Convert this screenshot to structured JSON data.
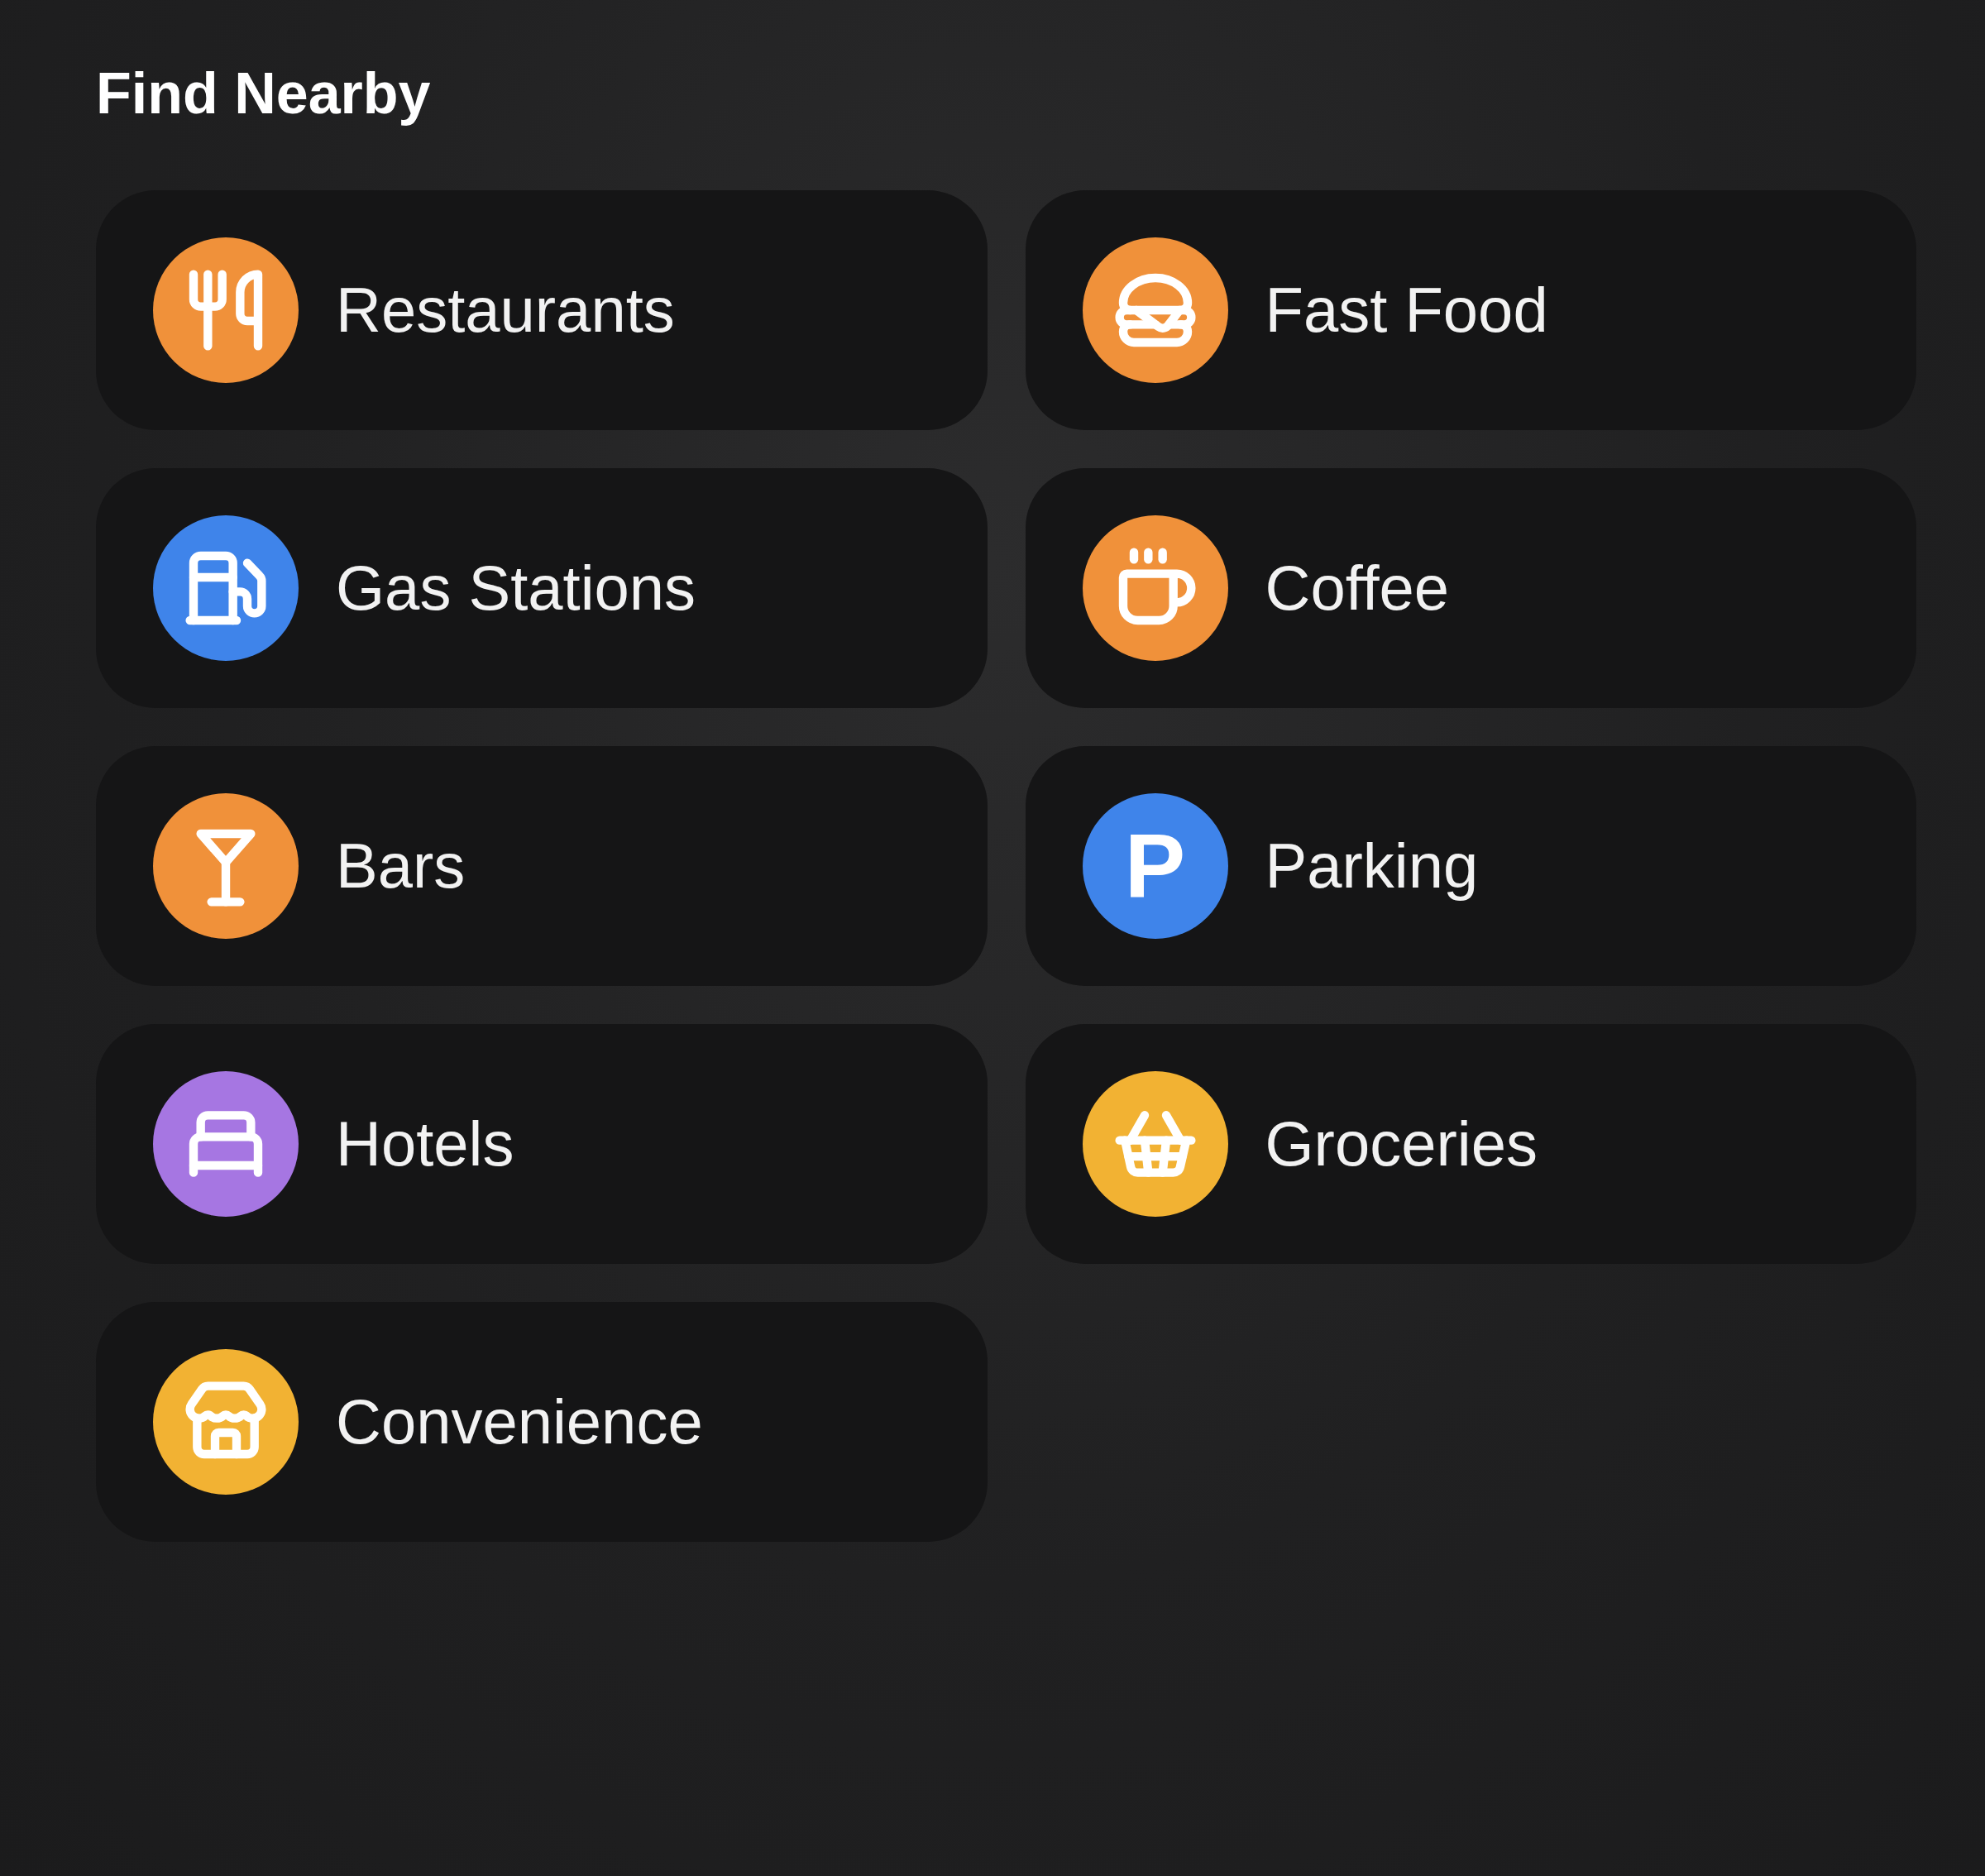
{
  "title": "Find Nearby",
  "categories": [
    {
      "label": "Restaurants",
      "color": "#f0913a"
    },
    {
      "label": "Fast Food",
      "color": "#f0913a"
    },
    {
      "label": "Gas Stations",
      "color": "#3f84ea"
    },
    {
      "label": "Coffee",
      "color": "#f0913a"
    },
    {
      "label": "Bars",
      "color": "#f0913a"
    },
    {
      "label": "Parking",
      "color": "#3f84ea",
      "glyph": "P"
    },
    {
      "label": "Hotels",
      "color": "#a676e2"
    },
    {
      "label": "Groceries",
      "color": "#f2b233"
    },
    {
      "label": "Convenience",
      "color": "#f2b233"
    }
  ]
}
